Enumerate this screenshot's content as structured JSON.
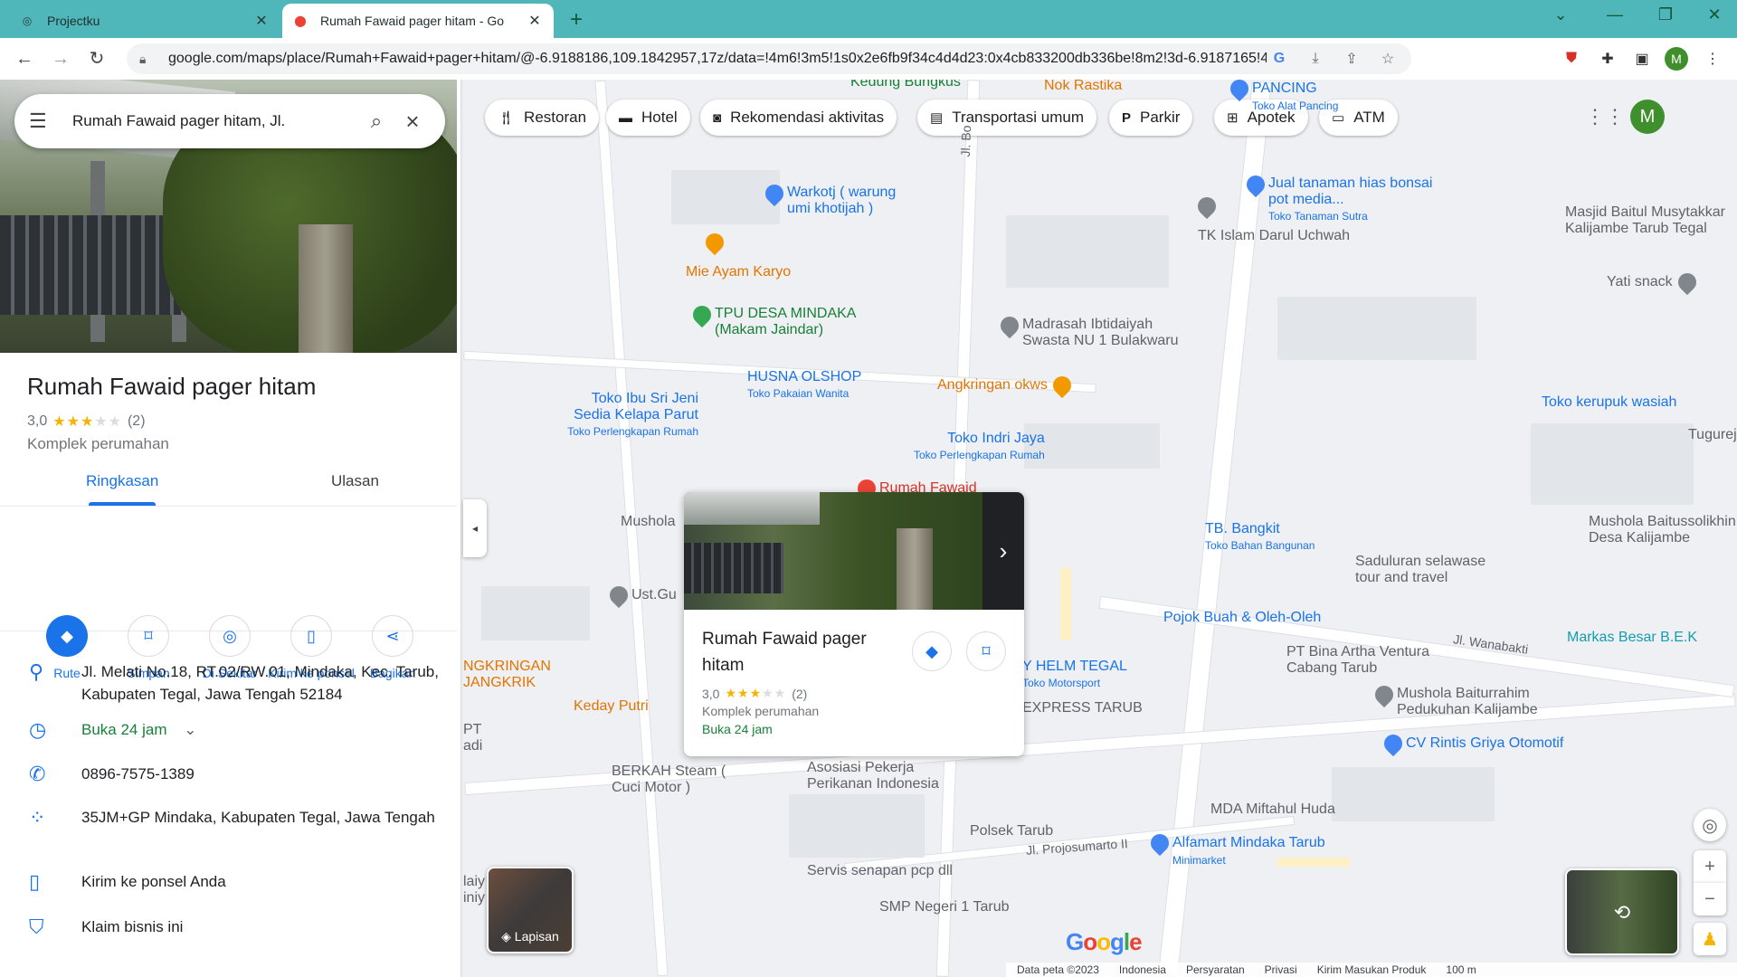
{
  "browser": {
    "tabs": [
      {
        "title": "Projectku",
        "active": false
      },
      {
        "title": "Rumah Fawaid pager hitam - Go",
        "active": true
      }
    ],
    "url": "google.com/maps/place/Rumah+Fawaid+pager+hitam/@-6.9188186,109.1842957,17z/data=!4m6!3m5!1s0x2e6fb9f34c4d4d23:0x4cb833200db336be!8m2!3d-6.9187165!4d1...",
    "profile_initial": "M"
  },
  "panel": {
    "search_query": "Rumah Fawaid pager hitam, Jl.",
    "place": {
      "name": "Rumah Fawaid pager hitam",
      "rating": "3,0",
      "rating_value": 3,
      "review_count": "(2)",
      "category": "Komplek perumahan"
    },
    "tabs": [
      {
        "label": "Ringkasan",
        "active": true
      },
      {
        "label": "Ulasan",
        "active": false
      }
    ],
    "actions": [
      {
        "label": "Rute",
        "icon": "directions-icon"
      },
      {
        "label": "Simpan",
        "icon": "bookmark-icon"
      },
      {
        "label": "Di Sekitar",
        "icon": "nearby-icon"
      },
      {
        "label": "Kirim ke ponsel",
        "icon": "send-to-phone-icon"
      },
      {
        "label": "Bagikan",
        "icon": "share-icon"
      }
    ],
    "info": [
      {
        "icon": "location-pin-icon",
        "text": "Jl. Melati No.18, RT.02/RW.01, Mindaka, Kec. Tarub, Kabupaten Tegal, Jawa Tengah 52184"
      },
      {
        "icon": "clock-icon",
        "text": "Buka 24 jam"
      },
      {
        "icon": "phone-icon",
        "text": "0896-7575-1389"
      },
      {
        "icon": "plus-code-icon",
        "text": "35JM+GP Mindaka, Kabupaten Tegal, Jawa Tengah"
      },
      {
        "icon": "send-to-phone-icon",
        "text": "Kirim ke ponsel Anda"
      },
      {
        "icon": "shield-icon",
        "text": "Klaim bisnis ini"
      }
    ]
  },
  "map": {
    "chips": [
      {
        "label": "Restoran",
        "icon": "restaurant-icon"
      },
      {
        "label": "Hotel",
        "icon": "hotel-icon"
      },
      {
        "label": "Rekomendasi aktivitas",
        "icon": "camera-icon"
      },
      {
        "label": "Transportasi umum",
        "icon": "transit-icon"
      },
      {
        "label": "Parkir",
        "icon": "parking-icon"
      },
      {
        "label": "Apotek",
        "icon": "pharmacy-icon"
      },
      {
        "label": "ATM",
        "icon": "atm-icon"
      }
    ],
    "pois": [
      {
        "name": "Kedung Bungkus",
        "sub": ""
      },
      {
        "name": "Nok Rastika",
        "sub": ""
      },
      {
        "name": "PANCING",
        "sub": "Toko Alat Pancing"
      },
      {
        "name": "Warkotj ( warung umi khotijah )",
        "sub": ""
      },
      {
        "name": "Jual tanaman hias bonsai pot media...",
        "sub": "Toko Tanaman Sutra"
      },
      {
        "name": "TK Islam Darul Uchwah",
        "sub": ""
      },
      {
        "name": "Masjid Baitul Musytakkar Kalijambe Tarub Tegal",
        "sub": ""
      },
      {
        "name": "Mie Ayam Karyo",
        "sub": ""
      },
      {
        "name": "Yati snack",
        "sub": ""
      },
      {
        "name": "TPU DESA MINDAKA (Makam Jaindar)",
        "sub": ""
      },
      {
        "name": "Madrasah Ibtidaiyah Swasta NU 1 Bulakwaru",
        "sub": ""
      },
      {
        "name": "HUSNA OLSHOP",
        "sub": "Toko Pakaian Wanita"
      },
      {
        "name": "Angkringan okws",
        "sub": ""
      },
      {
        "name": "Toko Ibu Sri Jeni Sedia Kelapa Parut",
        "sub": "Toko Perlengkapan Rumah"
      },
      {
        "name": "Toko kerupuk wasiah",
        "sub": ""
      },
      {
        "name": "Toko Indri Jaya",
        "sub": "Toko Perlengkapan Rumah"
      },
      {
        "name": "Tugurej",
        "sub": ""
      },
      {
        "name": "Rumah Fawaid",
        "sub": ""
      },
      {
        "name": "Mushola",
        "sub": ""
      },
      {
        "name": "TB. Bangkit",
        "sub": "Toko Bahan Bangunan"
      },
      {
        "name": "Mushola Baitussolikhin Desa Kalijambe",
        "sub": ""
      },
      {
        "name": "Saduluran selawase tour and travel",
        "sub": ""
      },
      {
        "name": "Ust.Gu",
        "sub": ""
      },
      {
        "name": "Pojok Buah & Oleh-Oleh",
        "sub": ""
      },
      {
        "name": "PT Bina Artha Ventura Cabang Tarub",
        "sub": ""
      },
      {
        "name": "Markas Besar B.E.K",
        "sub": ""
      },
      {
        "name": "NGKRINGAN JANGKRIK",
        "sub": ""
      },
      {
        "name": "Y HELM TEGAL",
        "sub": "Toko Motorsport"
      },
      {
        "name": "Mushola Baiturrahim Pedukuhan Kalijambe",
        "sub": ""
      },
      {
        "name": "Keday Putri",
        "sub": ""
      },
      {
        "name": "EXPRESS TARUB",
        "sub": ""
      },
      {
        "name": "PT adi",
        "sub": ""
      },
      {
        "name": "CV Rintis Griya Otomotif",
        "sub": ""
      },
      {
        "name": "BERKAH Steam ( Cuci Motor )",
        "sub": ""
      },
      {
        "name": "Asosiasi Pekerja Perikanan Indonesia",
        "sub": ""
      },
      {
        "name": "MDA Miftahul Huda",
        "sub": ""
      },
      {
        "name": "Polsek Tarub",
        "sub": ""
      },
      {
        "name": "Alfamart Mindaka Tarub",
        "sub": "Minimarket"
      },
      {
        "name": "laiy iniy",
        "sub": ""
      },
      {
        "name": "Servis senapan pcp dll",
        "sub": ""
      },
      {
        "name": "SMP Negeri 1 Tarub",
        "sub": ""
      }
    ],
    "streets": [
      "Jl. Bo",
      "Jl. Wanabakti",
      "Jl. Projosumarto II"
    ],
    "card": {
      "name": "Rumah Fawaid pager hitam",
      "rating": "3,0",
      "review_count": "(2)",
      "category": "Komplek perumahan",
      "status": "Buka 24 jam"
    },
    "layers_label": "Lapisan",
    "footer": [
      "Data peta ©2023",
      "Indonesia",
      "Persyaratan",
      "Privasi",
      "Kirim Masukan Produk",
      "100 m"
    ]
  }
}
